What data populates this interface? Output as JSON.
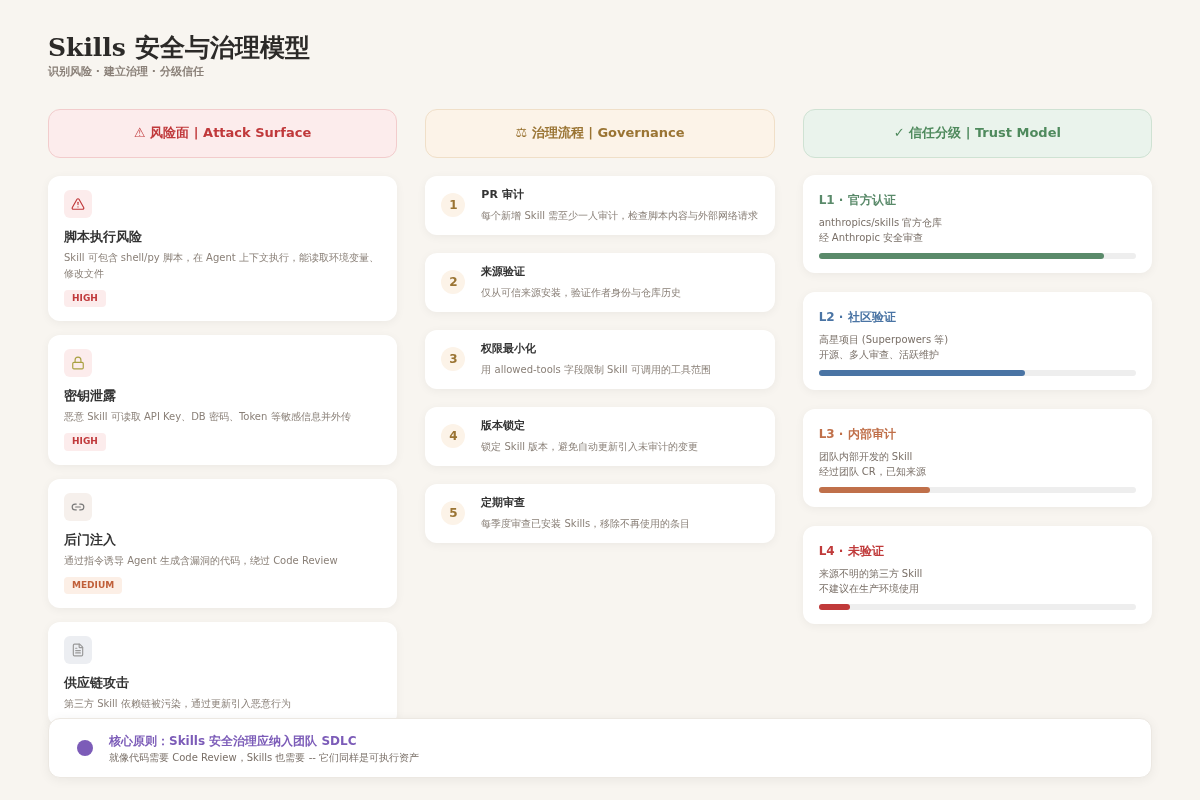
{
  "header": {
    "title": "Skills 安全与治理模型",
    "subtitle": "识别风险 · 建立治理 · 分级信任"
  },
  "columns": [
    {
      "kind": "risk",
      "heading": "⚠ 风险面 | Attack Surface"
    },
    {
      "kind": "governance",
      "heading": "⚖ 治理流程 | Governance"
    },
    {
      "kind": "trust",
      "heading": "✓ 信任分级 | Trust Model"
    }
  ],
  "risks": [
    {
      "title": "脚本执行风险",
      "description": "Skill 可包含 shell/py 脚本，在 Agent 上下文执行，能读取环境变量、修改文件",
      "severity": "HIGH",
      "kind": "high"
    },
    {
      "title": "密钥泄露",
      "description": "恶意 Skill 可读取 API Key、DB 密码、Token 等敏感信息并外传",
      "severity": "HIGH",
      "kind": "high"
    },
    {
      "title": "后门注入",
      "description": "通过指令诱导 Agent 生成含漏洞的代码，绕过 Code Review",
      "severity": "MEDIUM",
      "kind": "medium"
    },
    {
      "title": "供应链攻击",
      "description": "第三方 Skill 依赖链被污染，通过更新引入恶意行为"
    }
  ],
  "steps": [
    {
      "number": "1",
      "title": "PR 审计",
      "description": "每个新增 Skill 需至少一人审计，检查脚本内容与外部网络请求"
    },
    {
      "number": "2",
      "title": "来源验证",
      "description": "仅从可信来源安装，验证作者身份与仓库历史"
    },
    {
      "number": "3",
      "title": "权限最小化",
      "description": "用 allowed-tools 字段限制 Skill 可调用的工具范围"
    },
    {
      "number": "4",
      "title": "版本锁定",
      "description": "锁定 Skill 版本，避免自动更新引入未审计的变更"
    },
    {
      "number": "5",
      "title": "定期审查",
      "description": "每季度审查已安装 Skills，移除不再使用的条目"
    }
  ],
  "trust_levels": [
    {
      "title": "L1 · 官方认证",
      "lines": [
        "anthropics/skills 官方仓库",
        "经 Anthropic 安全审查"
      ],
      "level": 0.9,
      "color": "#5a8a6a"
    },
    {
      "title": "L2 · 社区验证",
      "lines": [
        "高星项目 (Superpowers 等)",
        "开源、多人审查、活跃维护"
      ],
      "level": 0.65,
      "color": "#4a74a4"
    },
    {
      "title": "L3 · 内部审计",
      "lines": [
        "团队内部开发的 Skill",
        "经过团队 CR，已知来源"
      ],
      "level": 0.35,
      "color": "#c0704a"
    },
    {
      "title": "L4 · 未验证",
      "lines": [
        "来源不明的第三方 Skill",
        "不建议在生产环境使用"
      ],
      "level": 0.1,
      "color": "#c03a3a"
    }
  ],
  "principle": {
    "title": "核心原则：Skills 安全治理应纳入团队 SDLC",
    "description": "就像代码需要 Code Review，Skills 也需要 -- 它们同样是可执行资产",
    "color": "#7c5cb8"
  }
}
